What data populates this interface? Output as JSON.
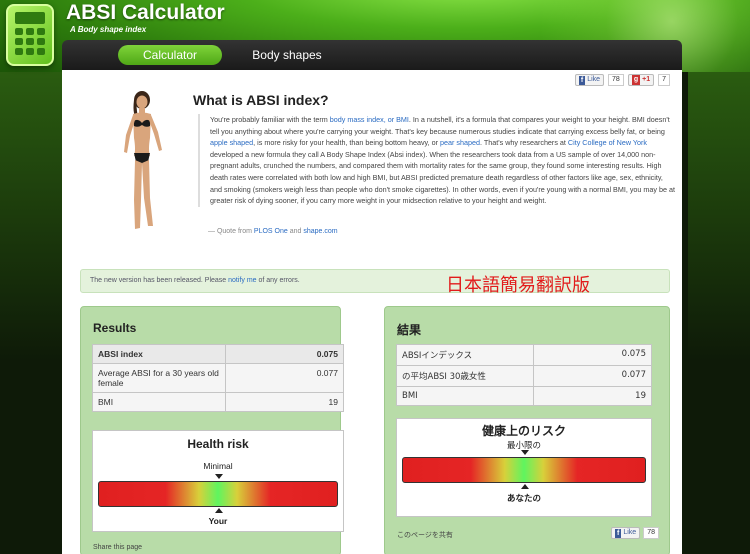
{
  "app": {
    "title": "ABSI Calculator",
    "subtitle": "A Body shape index"
  },
  "nav": {
    "tabs": [
      {
        "label": "Calculator",
        "active": true
      },
      {
        "label": "Body shapes",
        "active": false
      }
    ]
  },
  "social_top": {
    "like_label": "Like",
    "like_count": "78",
    "plus_label": "+1",
    "plus_count": "7"
  },
  "about": {
    "title": "What is ABSI index?",
    "q1": "You're probably familiar with the term ",
    "link_bmi": "body mass index, or BMI",
    "q2": ". In a nutshell, it's a formula that compares your weight to your height. BMI doesn't tell you anything about where you're carrying your weight. That's key because numerous studies indicate that carrying excess belly fat, or being ",
    "link_apple": "apple shaped",
    "q3": ", is more risky for your health, than being bottom heavy, or ",
    "link_pear": "pear shaped",
    "q4": ". That's why researchers at ",
    "link_college": "City College of New York",
    "q5": " developed a new formula they call A Body Shape Index (Absi index). When the researchers took data from a US sample of over 14,000 non-pregnant adults, crunched the numbers, and compared them with mortality rates for the same group, they found some interesting results. High death rates were correlated with both low and high BMI, but ABSI predicted premature death regardless of other factors like age, sex, ethnicity, and smoking (smokers weigh less than people who don't smoke cigarettes). In other words, even if you're young with a normal BMI, you may be at greater risk of dying sooner, if you carry more weight in your midsection relative to your height and weight.",
    "src_prefix": "— Quote from ",
    "src_link1": "PLOS One",
    "src_and": " and ",
    "src_link2": "shape.com"
  },
  "notice": {
    "text_prefix": "The new version has been released. Please ",
    "link": "notify me",
    "text_suffix": " of any errors.",
    "jp_label": "日本語簡易翻訳版"
  },
  "results_en": {
    "title": "Results",
    "rows": [
      {
        "label": "ABSI index",
        "value": "0.075"
      },
      {
        "label": "Average ABSI for a 30 years old female",
        "value": "0.077"
      },
      {
        "label": "BMI",
        "value": "19"
      }
    ],
    "gauge_title": "Health risk",
    "gauge_min": "Minimal",
    "gauge_your": "Your",
    "share": "Share this page"
  },
  "results_jp": {
    "title": "結果",
    "rows": [
      {
        "label": "ABSIインデックス",
        "value": "0.075"
      },
      {
        "label": "の平均ABSI 30歳女性",
        "value": "0.077"
      },
      {
        "label": "BMI",
        "value": "19"
      }
    ],
    "gauge_title": "健康上のリスク",
    "gauge_min": "最小限の",
    "gauge_your": "あなたの",
    "share": "このページを共有",
    "like_label": "Like",
    "like_count": "78"
  },
  "colors": {
    "brand_green": "#4fa716",
    "panel_green": "#b8dca8",
    "notice_red": "#e21b1b",
    "link_blue": "#2a6bc2"
  }
}
